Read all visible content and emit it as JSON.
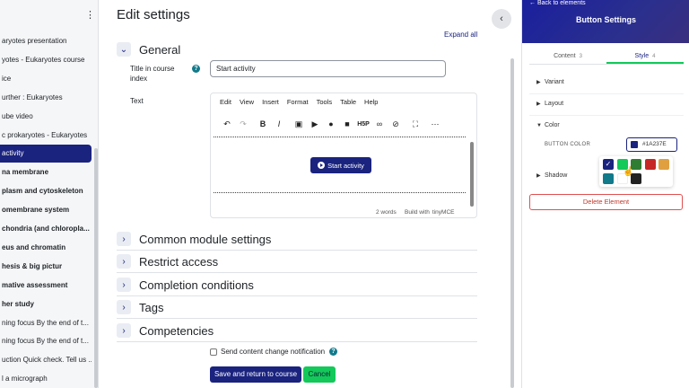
{
  "sidebar": {
    "items": [
      {
        "label": "aryotes presentation",
        "bold": false,
        "active": false
      },
      {
        "label": "yotes - Eukaryotes course",
        "bold": false,
        "active": false
      },
      {
        "label": "ice",
        "bold": false,
        "active": false
      },
      {
        "label": "urther : Eukaryotes",
        "bold": false,
        "active": false
      },
      {
        "label": "ube video",
        "bold": false,
        "active": false
      },
      {
        "label": "c prokaryotes - Eukaryotes",
        "bold": false,
        "active": false
      },
      {
        "label": "activity",
        "bold": false,
        "active": true
      },
      {
        "label": "na membrane",
        "bold": true,
        "active": false
      },
      {
        "label": "plasm and cytoskeleton",
        "bold": true,
        "active": false
      },
      {
        "label": "omembrane system",
        "bold": true,
        "active": false
      },
      {
        "label": "chondria (and chloropla...",
        "bold": true,
        "active": false
      },
      {
        "label": "eus and chromatin",
        "bold": true,
        "active": false
      },
      {
        "label": "hesis & big pictur",
        "bold": true,
        "active": false
      },
      {
        "label": "mative assessment",
        "bold": true,
        "active": false
      },
      {
        "label": "her study",
        "bold": true,
        "active": false
      },
      {
        "label": "ning focus By the end of t...",
        "bold": false,
        "active": false
      },
      {
        "label": "ning focus By the end of t...",
        "bold": false,
        "active": false
      },
      {
        "label": "uction Quick check. Tell us ...",
        "bold": false,
        "active": false
      },
      {
        "label": "l a micrograph",
        "bold": false,
        "active": false
      }
    ]
  },
  "main": {
    "title": "Edit settings",
    "expand_all": "Expand all",
    "general": "General",
    "title_label": "Title in course index",
    "title_value": "Start activity",
    "text_label": "Text",
    "editor": {
      "menus": [
        "Edit",
        "View",
        "Insert",
        "Format",
        "Tools",
        "Table",
        "Help"
      ],
      "button_text": "Start activity",
      "words": "2 words",
      "built_with": "Build with  tinyMCE"
    },
    "sections": [
      "Common module settings",
      "Restrict access",
      "Completion conditions",
      "Tags",
      "Competencies"
    ],
    "checkbox_label": "Send content change notification",
    "save_label": "Save and return to course",
    "cancel_label": "Cancel"
  },
  "panel": {
    "back": "← Back to elements",
    "title": "Button Settings",
    "tabs": [
      {
        "label": "Content",
        "num": "3"
      },
      {
        "label": "Style",
        "num": "4"
      }
    ],
    "variant": "Variant",
    "layout": "Layout",
    "color": "Color",
    "button_color_label": "BUTTON COLOR",
    "button_color_value": "#1A237E",
    "shadow": "Shadow",
    "delete": "Delete Element",
    "palette": [
      "#1a237e",
      "#12c95a",
      "#2e7d32",
      "#c62828",
      "#e0a040",
      "#117a8b",
      "#ffffff",
      "#222222"
    ]
  }
}
